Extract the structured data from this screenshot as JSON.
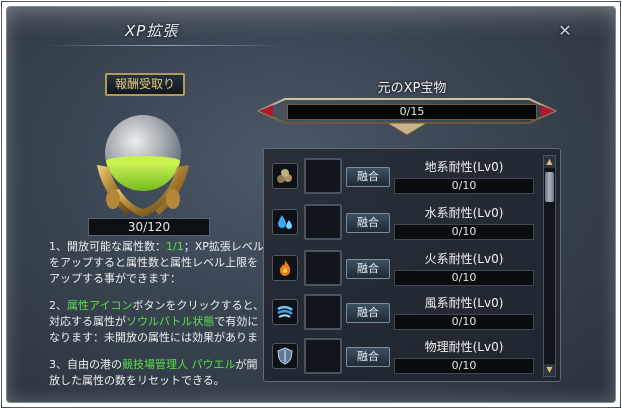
{
  "window": {
    "title": "XP拡張",
    "close_glyph": "✕"
  },
  "left": {
    "reward_button": "報酬受取り",
    "xp_value": "30/120",
    "desc1": {
      "a": "1、開放可能な属性数：",
      "b": "1/1",
      "c": "；XP拡張レベルをアップすると属性数と属性レベル上限をアップする事ができます："
    },
    "desc2": {
      "a": "2、",
      "b": "属性アイコン",
      "c": "ボタンをクリックすると、対応する属性が",
      "d": "ソウルバトル状態",
      "e": "で有効になります：未開放の属性には効果がありま"
    },
    "desc3": {
      "a": "3、自由の港の",
      "b": "競技場管理人 パウエル",
      "c": "が開放した属性の数をリセットできる。"
    }
  },
  "right": {
    "treasure_title": "元のXP宝物",
    "treasure_progress": "0/15",
    "treasure_progress_value": 0,
    "merge_label": "融合",
    "attributes": [
      {
        "name": "地系耐性(Lv0)",
        "progress": "0/10",
        "icon": "earth-icon"
      },
      {
        "name": "水系耐性(Lv0)",
        "progress": "0/10",
        "icon": "water-icon"
      },
      {
        "name": "火系耐性(Lv0)",
        "progress": "0/10",
        "icon": "fire-icon"
      },
      {
        "name": "風系耐性(Lv0)",
        "progress": "0/10",
        "icon": "wind-icon"
      },
      {
        "name": "物理耐性(Lv0)",
        "progress": "0/10",
        "icon": "shield-icon"
      }
    ],
    "scroll_up_glyph": "▲",
    "scroll_down_glyph": "▼"
  },
  "colors": {
    "highlight_green": "#59e04a",
    "gold": "#e4c97c",
    "orb_green": "#8fe21b"
  }
}
